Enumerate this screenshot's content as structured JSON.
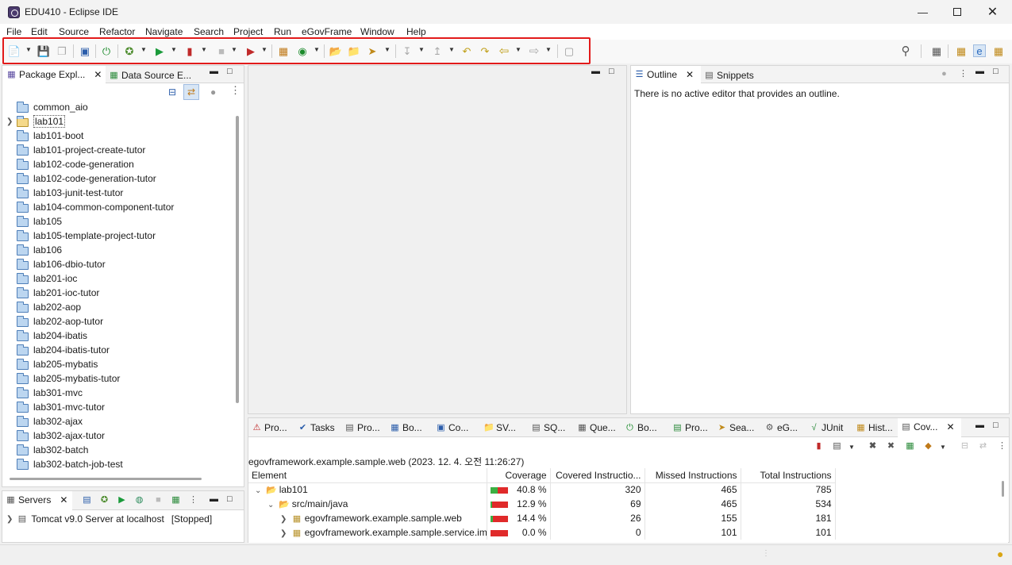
{
  "window": {
    "title": "EDU410 - Eclipse IDE"
  },
  "menu": [
    "File",
    "Edit",
    "Source",
    "Refactor",
    "Navigate",
    "Search",
    "Project",
    "Run",
    "eGovFrame",
    "Window",
    "Help"
  ],
  "left_panel": {
    "tabs": [
      "Package Expl...",
      "Data Source E..."
    ],
    "projects": [
      "common_aio",
      "lab101",
      "lab101-boot",
      "lab101-project-create-tutor",
      "lab102-code-generation",
      "lab102-code-generation-tutor",
      "lab103-junit-test-tutor",
      "lab104-common-component-tutor",
      "lab105",
      "lab105-template-project-tutor",
      "lab106",
      "lab106-dbio-tutor",
      "lab201-ioc",
      "lab201-ioc-tutor",
      "lab202-aop",
      "lab202-aop-tutor",
      "lab204-ibatis",
      "lab204-ibatis-tutor",
      "lab205-mybatis",
      "lab205-mybatis-tutor",
      "lab301-mvc",
      "lab301-mvc-tutor",
      "lab302-ajax",
      "lab302-ajax-tutor",
      "lab302-batch",
      "lab302-batch-job-test"
    ]
  },
  "servers_panel": {
    "tab": "Servers",
    "server": "Tomcat v9.0 Server at localhost",
    "state": "[Stopped]"
  },
  "outline_panel": {
    "tabs": [
      "Outline",
      "Snippets"
    ],
    "message": "There is no active editor that provides an outline."
  },
  "bottom_panel": {
    "tabs": [
      "Pro...",
      "Tasks",
      "Pro...",
      "Bo...",
      "Co...",
      "SV...",
      "SQ...",
      "Que...",
      "Bo...",
      "Pro...",
      "Sea...",
      "eG...",
      "JUnit",
      "Hist...",
      "Cov..."
    ],
    "session": "egovframework.example.sample.web (2023. 12. 4. 오전 11:26:27)",
    "columns": [
      "Element",
      "Coverage",
      "Covered Instructio...",
      "Missed Instructions",
      "Total Instructions"
    ],
    "rows": [
      {
        "name": "lab101",
        "coverage": "40.8 %",
        "covered": "320",
        "missed": "465",
        "total": "785",
        "fill": 0.408
      },
      {
        "name": "src/main/java",
        "coverage": "12.9 %",
        "covered": "69",
        "missed": "465",
        "total": "534",
        "fill": 0.129
      },
      {
        "name": "egovframework.example.sample.web",
        "coverage": "14.4 %",
        "covered": "26",
        "missed": "155",
        "total": "181",
        "fill": 0.144
      },
      {
        "name": "egovframework.example.sample.service.im",
        "coverage": "0.0 %",
        "covered": "0",
        "missed": "101",
        "total": "101",
        "fill": 0.0
      }
    ]
  },
  "colors": {
    "highlight": "#e21a1a",
    "coverage_green": "#3cb043",
    "coverage_red": "#e02a2a"
  }
}
